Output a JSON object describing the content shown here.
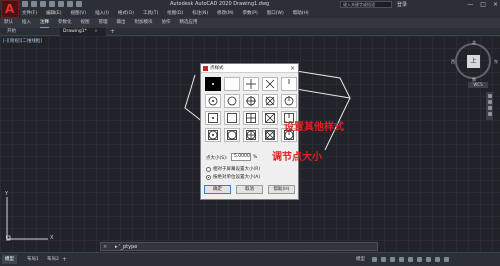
{
  "app": {
    "title": "Autodesk AutoCAD 2020   Drawing1.dwg",
    "logo_letter": "A",
    "search_placeholder": "键入关键字或短语",
    "login_label": "登录",
    "window_buttons": [
      "—",
      "□",
      "×"
    ]
  },
  "menubar": [
    "文件(F)",
    "编辑(E)",
    "视图(V)",
    "插入(I)",
    "格式(O)",
    "工具(T)",
    "绘图(D)",
    "标注(N)",
    "修改(M)",
    "参数(P)",
    "窗口(W)",
    "帮助(H)"
  ],
  "ribbon_tabs": [
    {
      "label": "默认",
      "active": false
    },
    {
      "label": "插入",
      "active": false
    },
    {
      "label": "注释",
      "active": true
    },
    {
      "label": "参数化",
      "active": false
    },
    {
      "label": "视图",
      "active": false
    },
    {
      "label": "管理",
      "active": false
    },
    {
      "label": "输出",
      "active": false
    },
    {
      "label": "附加模块",
      "active": false
    },
    {
      "label": "协作",
      "active": false
    },
    {
      "label": "精选应用",
      "active": false
    }
  ],
  "document_tabs": {
    "start": "开始",
    "drawing": "Drawing1*",
    "close_glyph": "×",
    "add_glyph": "+"
  },
  "viewport_label": "[-][俯视][二维线框]",
  "viewcube": {
    "face": "上",
    "north": "北",
    "south": "南",
    "west": "西",
    "east": "东",
    "wcs": "WCS"
  },
  "ucs": {
    "y_label": "Y",
    "x_label": "X"
  },
  "command_line": {
    "close_glyph": "×",
    "text": "▸ '_ptype"
  },
  "status_bar": {
    "tabs": [
      "模型",
      "布局1",
      "布局2"
    ],
    "add_glyph": "+",
    "model_label": "模型"
  },
  "dialog": {
    "title": "点样式",
    "close_glyph": "×",
    "size_label": "点大小(S):",
    "size_value": "5.0000",
    "unit_label": "%",
    "radio_relative": "相对于屏幕设置大小(R)",
    "radio_absolute": "按绝对单位设置大小(A)",
    "radio_selected": "absolute",
    "buttons": {
      "ok": "确定",
      "cancel": "取消",
      "help": "帮助(H)"
    },
    "selected_style_index": 0
  },
  "annotations": {
    "set_other_style": "设置其他样式",
    "adjust_point_size": "调节点大小"
  },
  "colors": {
    "canvas": "#212329",
    "annotation": "#e02020",
    "accent": "#4ea3ff",
    "logo": "#e8322e"
  }
}
